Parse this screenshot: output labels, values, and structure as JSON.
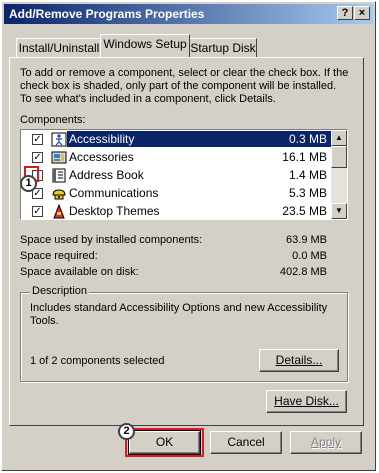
{
  "window": {
    "title": "Add/Remove Programs Properties",
    "help_btn": "?",
    "close_btn": "×"
  },
  "tabs": [
    {
      "label": "Install/Uninstall"
    },
    {
      "label": "Windows Setup"
    },
    {
      "label": "Startup Disk"
    }
  ],
  "intro_text": "To add or remove a component, select or clear the check box. If the check box is shaded, only part of the component will be installed. To see what's included in a component, click Details.",
  "components_label": "Components:",
  "components": [
    {
      "name": "Accessibility",
      "size": "0.3 MB",
      "checked": true,
      "selected": true,
      "icon": "accessibility-icon"
    },
    {
      "name": "Accessories",
      "size": "16.1 MB",
      "checked": true,
      "selected": false,
      "icon": "accessories-icon"
    },
    {
      "name": "Address Book",
      "size": "1.4 MB",
      "checked": false,
      "selected": false,
      "icon": "address-book-icon"
    },
    {
      "name": "Communications",
      "size": "5.3 MB",
      "checked": true,
      "selected": false,
      "icon": "communications-icon"
    },
    {
      "name": "Desktop Themes",
      "size": "23.5 MB",
      "checked": true,
      "selected": false,
      "icon": "desktop-themes-icon"
    }
  ],
  "space": {
    "installed_label": "Space used by installed components:",
    "installed_value": "63.9 MB",
    "required_label": "Space required:",
    "required_value": "0.0 MB",
    "available_label": "Space available on disk:",
    "available_value": "402.8 MB"
  },
  "description": {
    "label": "Description",
    "text": "Includes standard Accessibility Options and new Accessibility Tools.",
    "count": "1 of 2 components selected"
  },
  "buttons": {
    "details": "Details...",
    "have_disk": "Have Disk...",
    "ok": "OK",
    "cancel": "Cancel",
    "apply": "Apply"
  },
  "callouts": {
    "one": "1",
    "two": "2"
  },
  "colors": {
    "face": "#d4d0c8",
    "selection": "#0a246a",
    "callout_red": "#e01818"
  }
}
